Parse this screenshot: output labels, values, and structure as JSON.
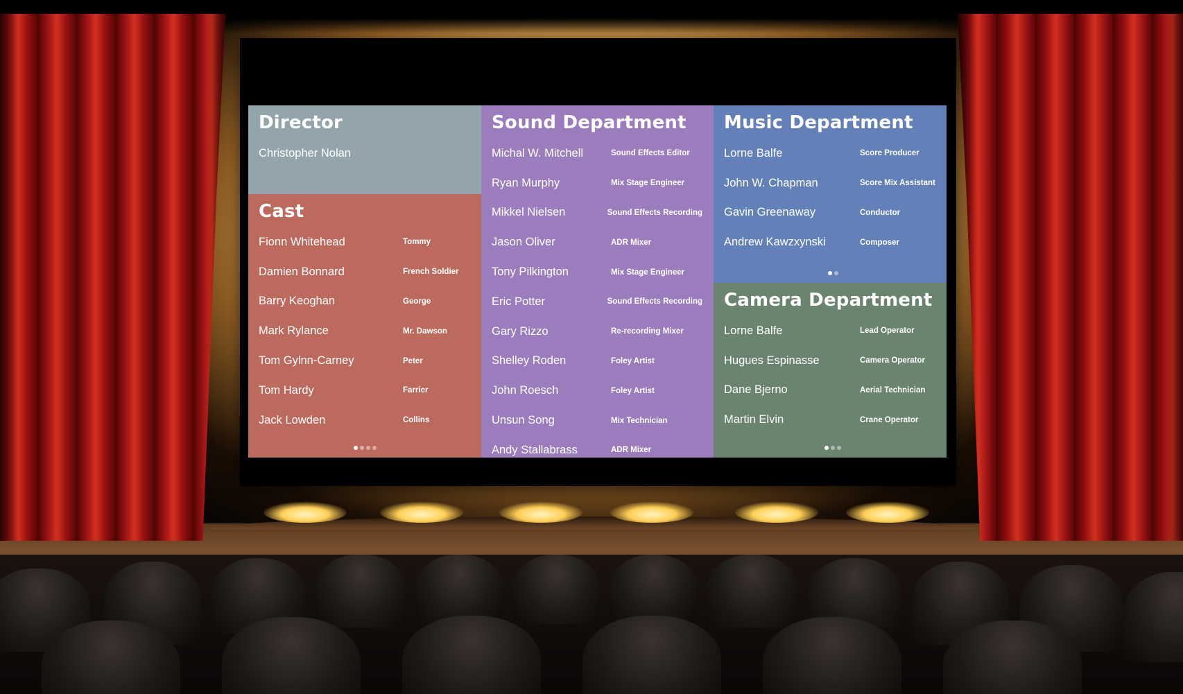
{
  "director": {
    "title": "Director",
    "people": [
      {
        "name": "Christopher Nolan"
      }
    ]
  },
  "cast": {
    "title": "Cast",
    "people": [
      {
        "name": "Fionn Whitehead",
        "role": "Tommy"
      },
      {
        "name": "Damien Bonnard",
        "role": "French Soldier"
      },
      {
        "name": "Barry Keoghan",
        "role": "George"
      },
      {
        "name": "Mark Rylance",
        "role": "Mr. Dawson"
      },
      {
        "name": "Tom Gylnn-Carney",
        "role": "Peter"
      },
      {
        "name": "Tom Hardy",
        "role": "Farrier"
      },
      {
        "name": "Jack Lowden",
        "role": "Collins"
      }
    ],
    "pages": 4,
    "current_page": 1
  },
  "sound": {
    "title": "Sound Department",
    "people": [
      {
        "name": "Michal W. Mitchell",
        "role": "Sound Effects Editor"
      },
      {
        "name": "Ryan Murphy",
        "role": "Mix Stage Engineer"
      },
      {
        "name": "Mikkel Nielsen",
        "role": "Sound Effects Recording"
      },
      {
        "name": "Jason Oliver",
        "role": "ADR Mixer"
      },
      {
        "name": "Tony Pilkington",
        "role": "Mix Stage Engineer"
      },
      {
        "name": "Eric Potter",
        "role": "Sound Effects Recording"
      },
      {
        "name": "Gary Rizzo",
        "role": "Re-recording Mixer"
      },
      {
        "name": "Shelley Roden",
        "role": "Foley Artist"
      },
      {
        "name": "John Roesch",
        "role": "Foley Artist"
      },
      {
        "name": "Unsun Song",
        "role": "Mix Technician"
      },
      {
        "name": "Andy Stallabrass",
        "role": "ADR Mixer"
      }
    ]
  },
  "music": {
    "title": "Music Department",
    "people": [
      {
        "name": "Lorne Balfe",
        "role": "Score Producer"
      },
      {
        "name": "John W. Chapman",
        "role": "Score Mix Assistant"
      },
      {
        "name": "Gavin Greenaway",
        "role": "Conductor"
      },
      {
        "name": "Andrew Kawzxynski",
        "role": "Composer"
      }
    ],
    "pages": 2,
    "current_page": 1
  },
  "camera": {
    "title": "Camera Department",
    "people": [
      {
        "name": "Lorne Balfe",
        "role": "Lead Operator"
      },
      {
        "name": "Hugues Espinasse",
        "role": "Camera Operator"
      },
      {
        "name": "Dane Bjerno",
        "role": "Aerial Technician"
      },
      {
        "name": "Martin Elvin",
        "role": "Crane Operator"
      }
    ],
    "pages": 3,
    "current_page": 1
  },
  "colors": {
    "director_panel": "#93a5ab",
    "cast_panel": "#bd6a5e",
    "sound_panel": "#9b7cbc",
    "music_panel": "#6380b8",
    "camera_panel": "#6a846f",
    "curtain": "#b01818"
  }
}
